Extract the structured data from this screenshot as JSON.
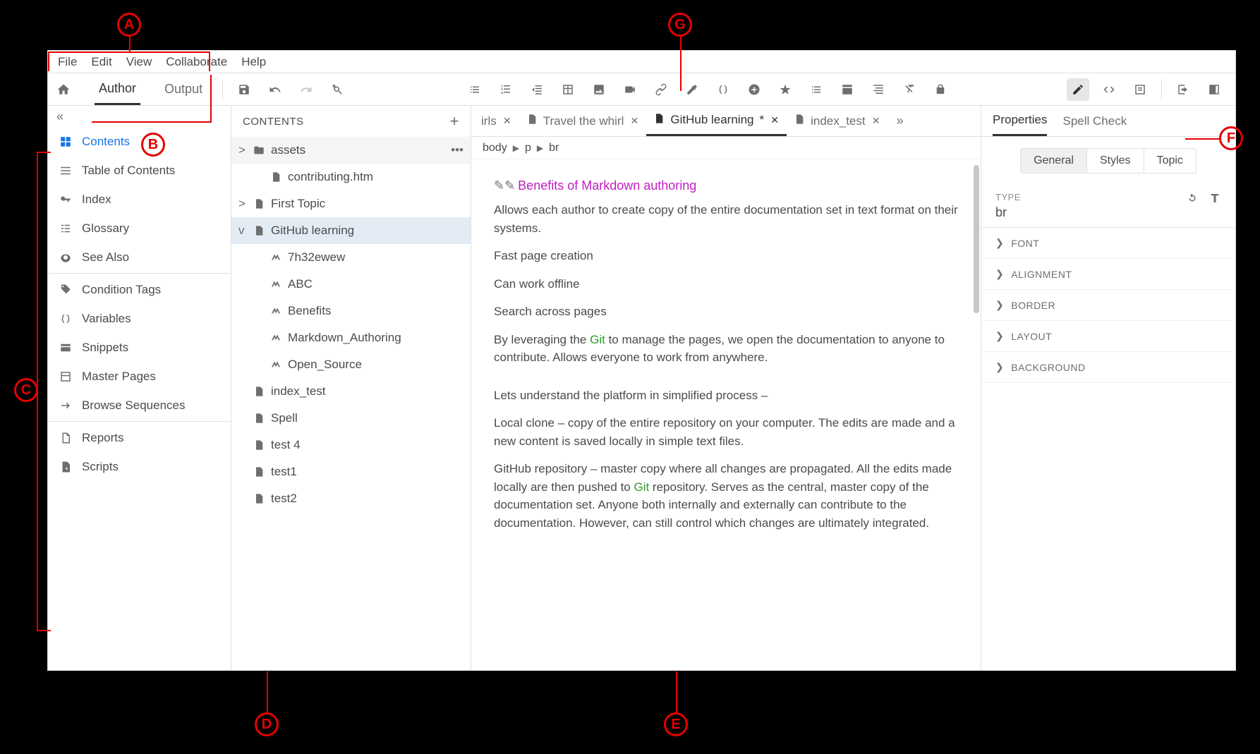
{
  "menubar": [
    "File",
    "Edit",
    "View",
    "Collaborate",
    "Help"
  ],
  "toolbar_tabs": {
    "author": "Author",
    "output": "Output"
  },
  "leftbar": {
    "items": [
      {
        "label": "Contents",
        "active": true
      },
      {
        "label": "Table of Contents"
      },
      {
        "label": "Index"
      },
      {
        "label": "Glossary"
      },
      {
        "label": "See Also"
      },
      {
        "label": "Condition Tags"
      },
      {
        "label": "Variables"
      },
      {
        "label": "Snippets"
      },
      {
        "label": "Master Pages"
      },
      {
        "label": "Browse Sequences"
      },
      {
        "label": "Reports"
      },
      {
        "label": "Scripts"
      }
    ]
  },
  "contents": {
    "title": "CONTENTS",
    "tree": [
      {
        "label": "assets",
        "type": "folder",
        "chev": ">",
        "indent": 0
      },
      {
        "label": "contributing.htm",
        "type": "file",
        "indent": 1
      },
      {
        "label": "First Topic",
        "type": "topic",
        "chev": ">",
        "indent": 0
      },
      {
        "label": "GitHub learning",
        "type": "topic",
        "chev": "v",
        "indent": 0,
        "selected": true
      },
      {
        "label": "7h32ewew",
        "type": "md",
        "indent": 1
      },
      {
        "label": "ABC",
        "type": "md",
        "indent": 1
      },
      {
        "label": "Benefits",
        "type": "md",
        "indent": 1
      },
      {
        "label": "Markdown_Authoring",
        "type": "md",
        "indent": 1
      },
      {
        "label": "Open_Source",
        "type": "md",
        "indent": 1
      },
      {
        "label": "index_test",
        "type": "file",
        "indent": 0
      },
      {
        "label": "Spell",
        "type": "file",
        "indent": 0
      },
      {
        "label": "test 4",
        "type": "file",
        "indent": 0
      },
      {
        "label": "test1",
        "type": "file",
        "indent": 0
      },
      {
        "label": "test2",
        "type": "file",
        "indent": 0
      }
    ]
  },
  "tabs": [
    {
      "label": "irls",
      "partial": true
    },
    {
      "label": "Travel the whirl"
    },
    {
      "label": "GitHub learning",
      "active": true,
      "dirty": true
    },
    {
      "label": "index_test"
    }
  ],
  "breadcrumb": [
    "body",
    "p",
    "br"
  ],
  "doc": {
    "heading": "Benefits of Markdown authoring",
    "p1": "Allows each author to create copy of the entire documentation set in text format on their systems.",
    "p2": "Fast page creation",
    "p3": "Can work offline",
    "p4": "Search across pages",
    "p5a": "By leveraging the ",
    "p5git": "Git",
    "p5b": " to manage the pages, we open the documentation to anyone to contribute. Allows everyone to work from anywhere.",
    "p6": "Lets understand the platform in simplified process –",
    "p7": "Local clone – copy of the entire repository on your computer. The edits are made and a new content is saved locally in simple text files.",
    "p8a": "GitHub repository – master copy where all changes are propagated. All the edits made locally are then pushed to ",
    "p8git": "Git",
    "p8b": " repository. Serves as the central, master copy of the documentation set. Anyone both internally and externally can contribute to the documentation. However, can still control which changes are ultimately integrated."
  },
  "right": {
    "tabs": {
      "properties": "Properties",
      "spell": "Spell Check"
    },
    "segments": {
      "general": "General",
      "styles": "Styles",
      "topic": "Topic"
    },
    "type_label": "TYPE",
    "type_value": "br",
    "accordion": [
      "FONT",
      "ALIGNMENT",
      "BORDER",
      "LAYOUT",
      "BACKGROUND"
    ]
  },
  "callouts": {
    "A": "A",
    "B": "B",
    "C": "C",
    "D": "D",
    "E": "E",
    "F": "F",
    "G": "G"
  }
}
